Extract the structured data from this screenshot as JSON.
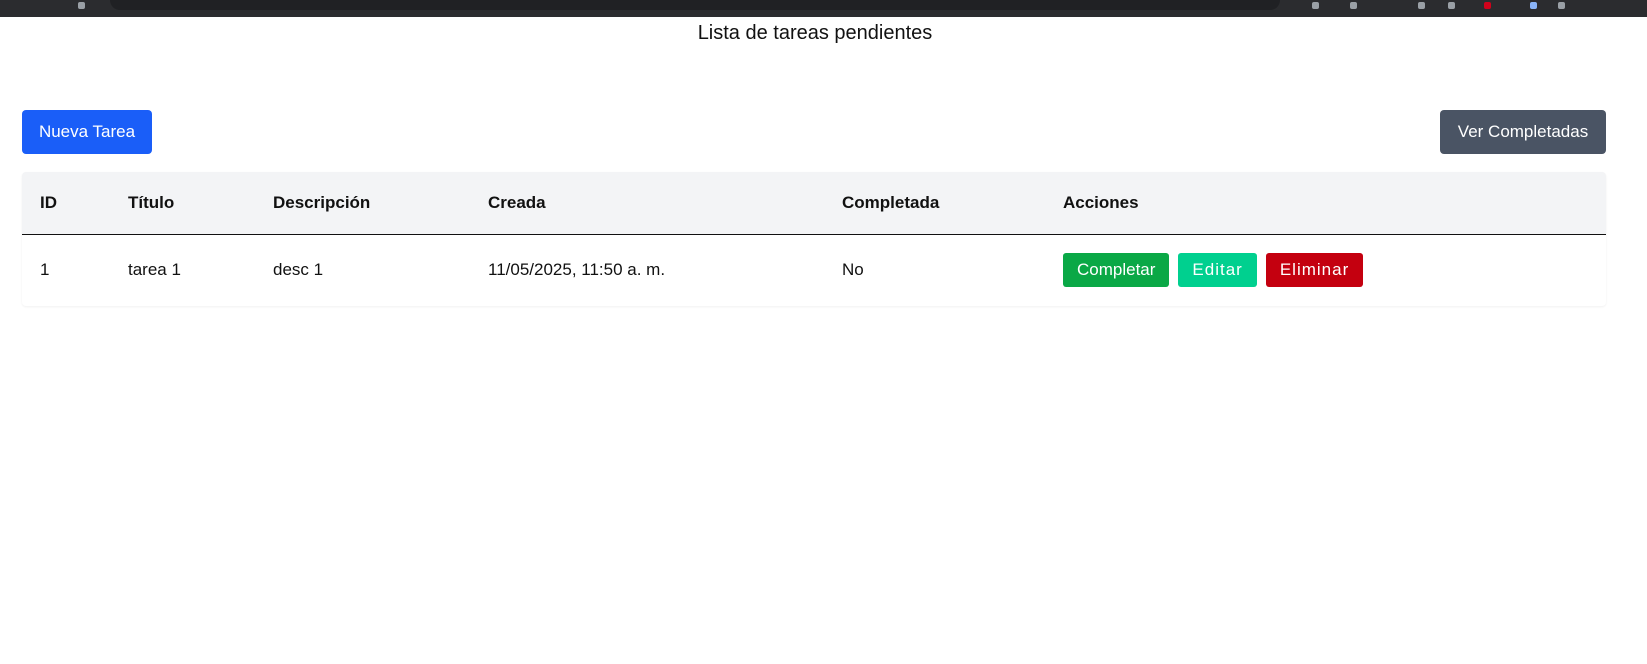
{
  "page": {
    "title": "Lista de tareas pendientes"
  },
  "toolbar": {
    "new_task_label": "Nueva Tarea",
    "view_completed_label": "Ver Completadas"
  },
  "table": {
    "headers": [
      "ID",
      "Título",
      "Descripción",
      "Creada",
      "Completada",
      "Acciones"
    ],
    "rows": [
      {
        "id": "1",
        "title": "tarea 1",
        "description": "desc 1",
        "created": "11/05/2025, 11:50 a. m.",
        "completed": "No",
        "actions": {
          "complete_label": "Completar",
          "edit_label": "Editar",
          "delete_label": "Eliminar"
        }
      }
    ]
  },
  "colors": {
    "primary": "#1a5ef8",
    "secondary": "#4a5464",
    "success": "#0aa846",
    "info": "#00d08f",
    "danger": "#c4000f"
  }
}
